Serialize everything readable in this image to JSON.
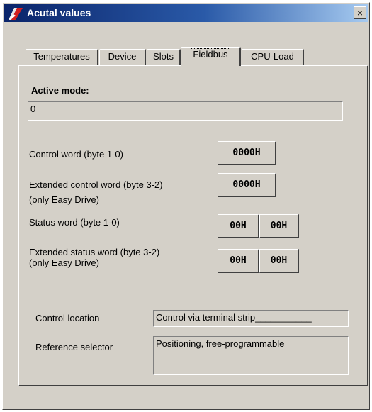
{
  "window": {
    "title": "Acutal values",
    "close_glyph": "×",
    "icon": "app-logo-icon"
  },
  "tabs": [
    {
      "label": "Temperatures",
      "active": false
    },
    {
      "label": "Device",
      "active": false
    },
    {
      "label": "Slots",
      "active": false
    },
    {
      "label": "Fieldbus",
      "active": true
    },
    {
      "label": "CPU-Load",
      "active": false
    }
  ],
  "fieldbus": {
    "active_mode_label": "Active mode:",
    "active_mode_value": "0",
    "control_word_label": "Control word (byte 1-0)",
    "control_word_value": "0000H",
    "ext_control_word_label_line1": "Extended control word (byte 3-2)",
    "ext_control_word_label_line2": "(only Easy Drive)",
    "ext_control_word_value": "0000H",
    "status_word_label": "Status word (byte 1-0)",
    "status_word_high": "00H",
    "status_word_low": "00H",
    "ext_status_word_label_line1": "Extended status word (byte 3-2)",
    "ext_status_word_label_line2": "(only Easy Drive)",
    "ext_status_word_high": "00H",
    "ext_status_word_low": "00H",
    "control_location_label": "Control location",
    "control_location_value": "Control via terminal strip___________",
    "reference_selector_label": "Reference selector",
    "reference_selector_value": "Positioning, free-programmable"
  }
}
